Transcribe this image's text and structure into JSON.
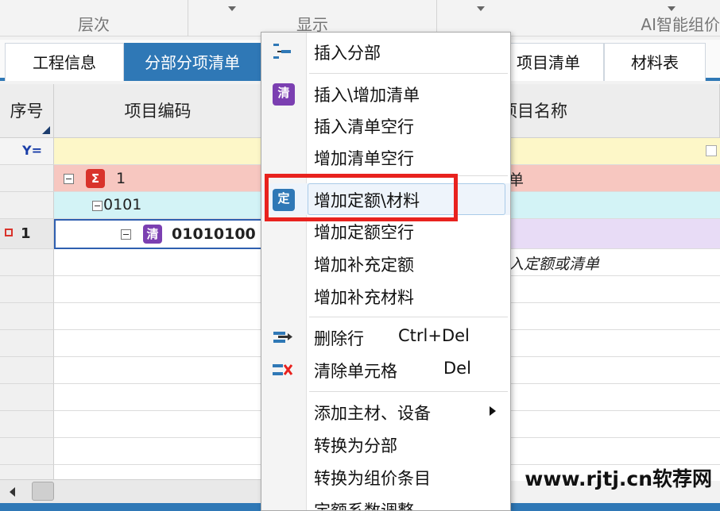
{
  "ribbon": {
    "groups": [
      "层次",
      "显示",
      "AI智能组价"
    ]
  },
  "tabs": [
    "工程信息",
    "分部分项清单",
    "项目清单",
    "材料表"
  ],
  "grid": {
    "headers": {
      "seq": "序号",
      "code": "项目编码",
      "name": "项目名称"
    },
    "rows": [
      {
        "code": "1",
        "name": "单"
      },
      {
        "code": "0101",
        "name": ""
      },
      {
        "seq": "1",
        "code": "01010100",
        "name": ""
      },
      {
        "code": "",
        "name": "入定额或清单"
      }
    ]
  },
  "menu": {
    "items": [
      {
        "label": "插入分部",
        "shortcut": "",
        "icon": "insert-section-icon"
      },
      {
        "label": "插入\\增加清单",
        "shortcut": "",
        "icon": "qing-list-icon"
      },
      {
        "label": "插入清单空行",
        "shortcut": ""
      },
      {
        "label": "增加清单空行",
        "shortcut": ""
      },
      {
        "label": "增加定额\\材料",
        "shortcut": "",
        "icon": "quota-material-icon"
      },
      {
        "label": "增加定额空行",
        "shortcut": ""
      },
      {
        "label": "增加补充定额",
        "shortcut": ""
      },
      {
        "label": "增加补充材料",
        "shortcut": ""
      },
      {
        "label": "删除行",
        "shortcut": "Ctrl+Del",
        "icon": "delete-row-icon"
      },
      {
        "label": "清除单元格",
        "shortcut": "Del",
        "icon": "clear-cell-icon"
      },
      {
        "label": "添加主材、设备",
        "shortcut": ""
      },
      {
        "label": "转换为分部",
        "shortcut": ""
      },
      {
        "label": "转换为组价条目",
        "shortcut": ""
      },
      {
        "label": "定额系数调整",
        "shortcut": ""
      }
    ]
  },
  "watermark": "www.rjtj.cn软荐网",
  "colors": {
    "accent": "#2f78b6",
    "highlight_box": "#e8221e",
    "qing_badge": "#7b3fb1",
    "sum_badge": "#d9332b"
  }
}
